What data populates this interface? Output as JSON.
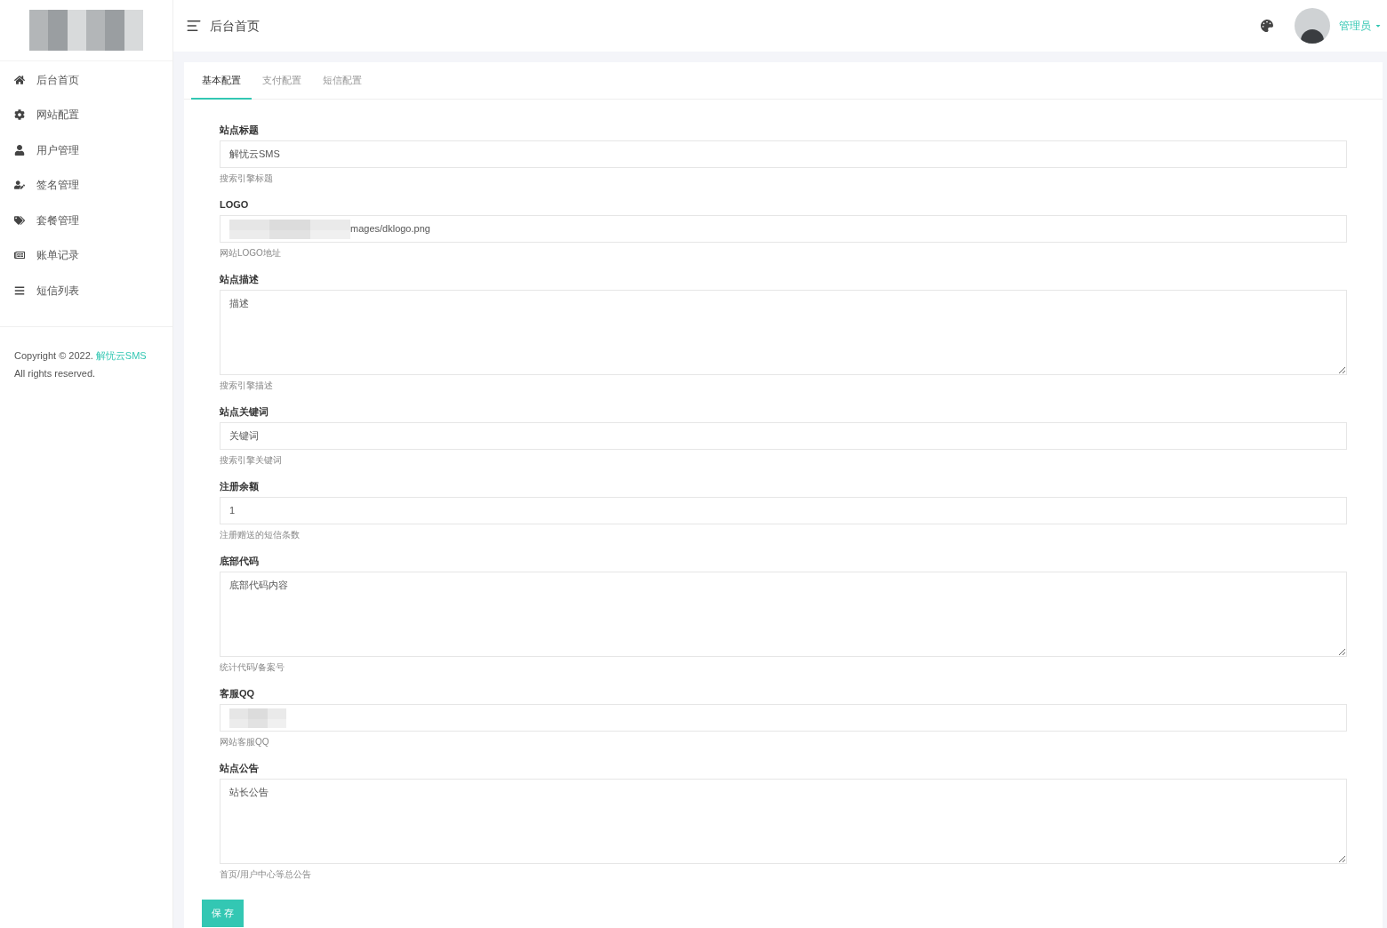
{
  "sidebar": {
    "logo": {
      "redacted": true
    },
    "items": [
      {
        "label": "后台首页"
      },
      {
        "label": "网站配置"
      },
      {
        "label": "用户管理"
      },
      {
        "label": "签名管理"
      },
      {
        "label": "套餐管理"
      },
      {
        "label": "账单记录"
      },
      {
        "label": "短信列表"
      }
    ],
    "copyright": {
      "prefix": "Copyright © 2022.",
      "link": "解忧云SMS",
      "suffix": "All rights reserved."
    }
  },
  "header": {
    "title": "后台首页",
    "user": "管理员"
  },
  "tabs": [
    {
      "label": "基本配置",
      "selected": true
    },
    {
      "label": "支付配置",
      "selected": false
    },
    {
      "label": "短信配置",
      "selected": false
    }
  ],
  "form": {
    "fields": [
      {
        "kind": "input",
        "label": "站点标题",
        "value": "解忧云SMS",
        "help": "搜索引擎标题"
      },
      {
        "kind": "input",
        "label": "LOGO",
        "value": "mages/dklogo.png",
        "redacted": true,
        "help": "网站LOGO地址"
      },
      {
        "kind": "textarea",
        "label": "站点描述",
        "value": "描述",
        "help": "搜索引擎描述"
      },
      {
        "kind": "input",
        "label": "站点关键词",
        "value": "关键词",
        "help": "搜索引擎关键词"
      },
      {
        "kind": "input",
        "label": "注册余额",
        "value": "1",
        "help": "注册赠送的短信条数"
      },
      {
        "kind": "textarea",
        "label": "底部代码",
        "value": "底部代码内容",
        "help": "统计代码/备案号"
      },
      {
        "kind": "input",
        "label": "客服QQ",
        "redacted": true,
        "help": "网站客服QQ"
      },
      {
        "kind": "textarea",
        "label": "站点公告",
        "value": "站长公告",
        "help": "首页/用户中心等总公告"
      }
    ],
    "submit": "保 存"
  }
}
